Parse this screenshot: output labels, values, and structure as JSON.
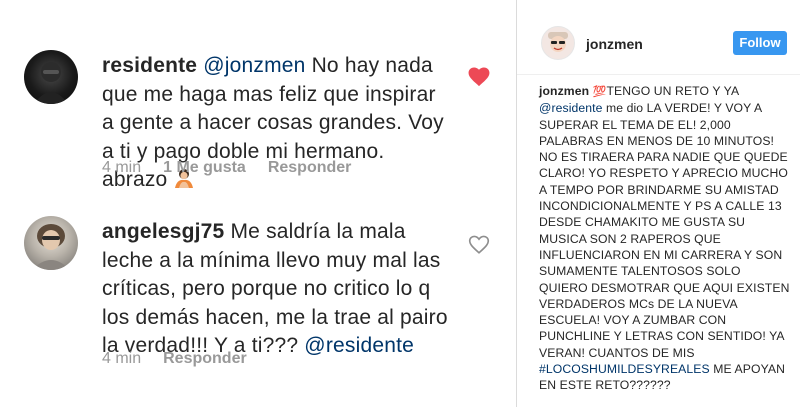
{
  "comments": [
    {
      "username": "residente",
      "mention": "@jonzmen",
      "text": " No hay nada que me haga mas feliz que inspirar a gente a hacer cosas grandes. Voy a ti y pago doble mi hermano. abrazo",
      "time": "4 min",
      "likes": "1 Me gusta",
      "reply": "Responder",
      "liked": true
    },
    {
      "username": "angelesgj75",
      "text": " Me saldría la mala leche a la mínima llevo muy mal las críticas, pero porque no critico lo q los demás hacen, me la trae al pairo la verdad!!! Y a ti??? ",
      "mention": "@residente",
      "time": "4 min",
      "reply": "Responder",
      "liked": false
    }
  ],
  "post": {
    "username": "jonzmen",
    "follow_label": "Follow",
    "caption_user": "jonzmen",
    "caption_emoji": "💯",
    "caption_part1": "TENGO UN RETO Y YA ",
    "caption_mention": "@residente",
    "caption_part2": " me dio LA VERDE! Y VOY A SUPERAR EL TEMA DE EL! 2,000 PALABRAS EN MENOS DE 10 MINUTOS! NO ES TIRAERA PARA NADIE QUE QUEDE CLARO! YO RESPETO Y APRECIO MUCHO A TEMPO POR BRINDARME SU AMISTAD INCONDICIONALMENTE Y PS A CALLE 13 DESDE CHAMAKITO ME GUSTA SU MUSICA SON 2 RAPEROS QUE INFLUENCIARON EN MI CARRERA Y SON SUMAMENTE TALENTOSOS SOLO QUIERO DESMOTRAR QUE AQUI EXISTEN VERDADEROS MCs DE LA NUEVA ESCUELA! VOY A ZUMBAR CON PUNCHLINE Y LETRAS CON SENTIDO! YA VERAN! CUANTOS DE MIS ",
    "caption_hashtag": "#LOCOSHUMILDESYREALES",
    "caption_part3": " ME APOYAN EN ESTE RETO??????"
  },
  "colors": {
    "text": "#262626",
    "link": "#003569",
    "meta": "#999999",
    "heart_liked": "#ed4956",
    "follow_bg": "#3897f0"
  },
  "icons": [
    "heart-filled-icon",
    "heart-outline-icon",
    "hands-emoji-icon",
    "hundred-points-emoji-icon"
  ]
}
